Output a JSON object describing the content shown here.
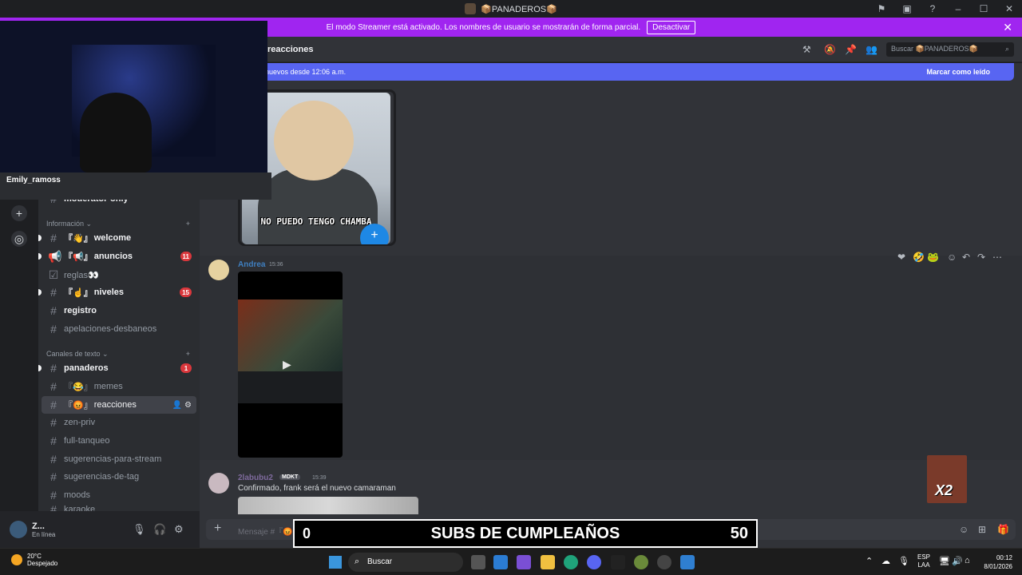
{
  "titlebar": {
    "title": "📦PANADEROS📦",
    "icons": [
      "inbox-icon",
      "help-icon"
    ]
  },
  "streamer": {
    "message": "El modo Streamer está activado. Los nombres de usuario se mostrarán de forma parcial.",
    "button": "Desactivar"
  },
  "overlay": {
    "username": "Emily_ramoss"
  },
  "sidebar": {
    "top_channels": [
      {
        "name": "reglas"
      },
      {
        "name": "moderator-only"
      }
    ],
    "category_info": "Información ⌄",
    "info_channels": [
      {
        "prefix": "『👋』",
        "name": "welcome",
        "badge": ""
      },
      {
        "prefix": "『📢』",
        "name": "anuncios",
        "badge": "11"
      },
      {
        "prefix": "",
        "name": "reglas👀",
        "badge": ""
      },
      {
        "prefix": "『☝』",
        "name": "niveles",
        "badge": "15"
      },
      {
        "prefix": "",
        "name": "registro",
        "badge": ""
      },
      {
        "prefix": "",
        "name": "apelaciones-desbaneos",
        "badge": ""
      }
    ],
    "category_text": "Canales de texto ⌄",
    "text_channels": [
      {
        "prefix": "",
        "name": "panaderos",
        "badge": "1"
      },
      {
        "prefix": "『😂』",
        "name": "memes",
        "badge": ""
      },
      {
        "prefix": "『😡』",
        "name": "reacciones",
        "badge": ""
      },
      {
        "prefix": "",
        "name": "zen-priv",
        "badge": ""
      },
      {
        "prefix": "",
        "name": "full-tanqueo",
        "badge": ""
      },
      {
        "prefix": "",
        "name": "sugerencias-para-stream",
        "badge": ""
      },
      {
        "prefix": "",
        "name": "sugerencias-de-tag",
        "badge": ""
      },
      {
        "prefix": "",
        "name": "moods",
        "badge": ""
      },
      {
        "prefix": "",
        "name": "karaoke",
        "badge": ""
      }
    ],
    "user": {
      "name": "Z...",
      "status": "En línea"
    }
  },
  "header": {
    "channel": "reacciones",
    "search_placeholder": "Buscar 📦PANADEROS📦"
  },
  "newbar": {
    "left": "nuevos desde 12:06 a.m.",
    "right": "Marcar como leído"
  },
  "meme": {
    "caption": "NO PUEDO TENGO CHAMBA"
  },
  "messages": [
    {
      "author": "Andrea",
      "time": "15:36",
      "author_color": "#3f7fc0"
    },
    {
      "author": "2labubu2",
      "tag": "MDKT",
      "time": "15:39",
      "text": "Confirmado, frank será el nuevo camaraman",
      "author_color": "#7e6a9c"
    }
  ],
  "composer": {
    "placeholder": "Mensaje #『😡』reacciones"
  },
  "subs": {
    "left": "0",
    "center": "SUBS DE CUMPLEAÑOS",
    "right": "50"
  },
  "overlay_x2": "X2",
  "taskbar": {
    "weather_temp": "20°C",
    "weather_desc": "Despejado",
    "search": "Buscar",
    "lang1": "ESP",
    "lang2": "LAA",
    "time": "00:12",
    "date": "8/01/2026"
  }
}
